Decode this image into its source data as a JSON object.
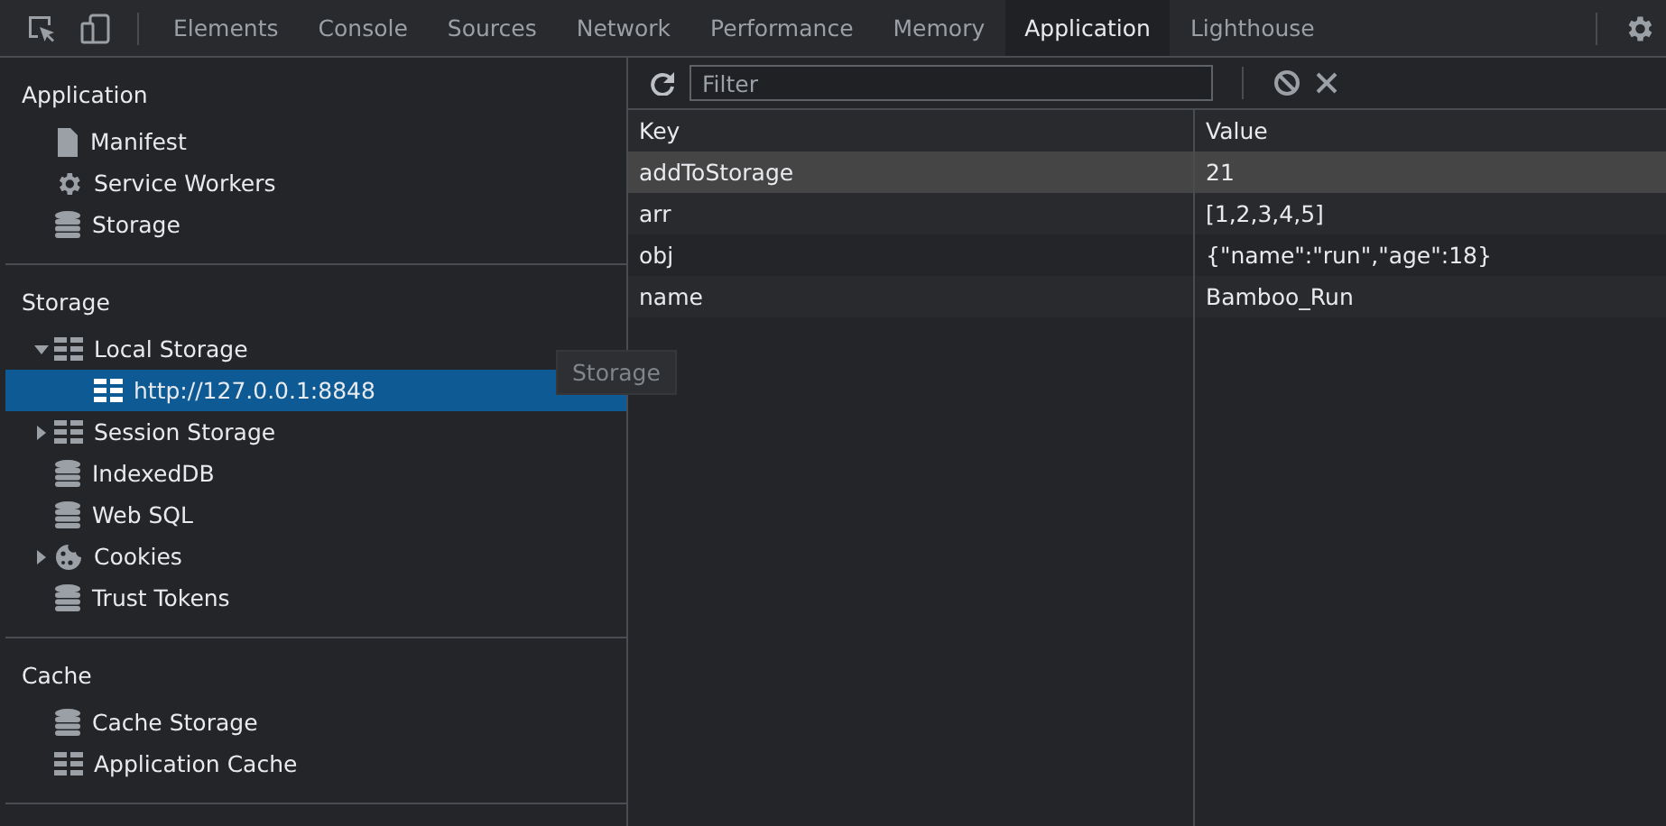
{
  "tabs": [
    {
      "label": "Elements",
      "selected": false
    },
    {
      "label": "Console",
      "selected": false
    },
    {
      "label": "Sources",
      "selected": false
    },
    {
      "label": "Network",
      "selected": false
    },
    {
      "label": "Performance",
      "selected": false
    },
    {
      "label": "Memory",
      "selected": false
    },
    {
      "label": "Application",
      "selected": true
    },
    {
      "label": "Lighthouse",
      "selected": false
    }
  ],
  "sidebar": {
    "sections": [
      {
        "title": "Application",
        "items": [
          {
            "label": "Manifest",
            "kind": "file"
          },
          {
            "label": "Service Workers",
            "kind": "gear"
          },
          {
            "label": "Storage",
            "kind": "database"
          }
        ]
      },
      {
        "title": "Storage",
        "items": [
          {
            "label": "Local Storage",
            "kind": "table",
            "expanded": true,
            "children": [
              {
                "label": "http://127.0.0.1:8848",
                "kind": "table",
                "selected": true
              }
            ]
          },
          {
            "label": "Session Storage",
            "kind": "table",
            "expanded": false
          },
          {
            "label": "IndexedDB",
            "kind": "database"
          },
          {
            "label": "Web SQL",
            "kind": "database"
          },
          {
            "label": "Cookies",
            "kind": "cookie",
            "expanded": false
          },
          {
            "label": "Trust Tokens",
            "kind": "database"
          }
        ]
      },
      {
        "title": "Cache",
        "items": [
          {
            "label": "Cache Storage",
            "kind": "database"
          },
          {
            "label": "Application Cache",
            "kind": "table"
          }
        ]
      }
    ]
  },
  "tooltip": "Storage",
  "filter": {
    "placeholder": "Filter"
  },
  "table": {
    "columns": [
      "Key",
      "Value"
    ],
    "rows": [
      {
        "cells": [
          "addToStorage",
          "21"
        ],
        "selected": true
      },
      {
        "cells": [
          "arr",
          "[1,2,3,4,5]"
        ],
        "selected": false
      },
      {
        "cells": [
          "obj",
          "{\"name\":\"run\",\"age\":18}"
        ],
        "selected": false
      },
      {
        "cells": [
          "name",
          "Bamboo_Run"
        ],
        "selected": false
      }
    ]
  }
}
